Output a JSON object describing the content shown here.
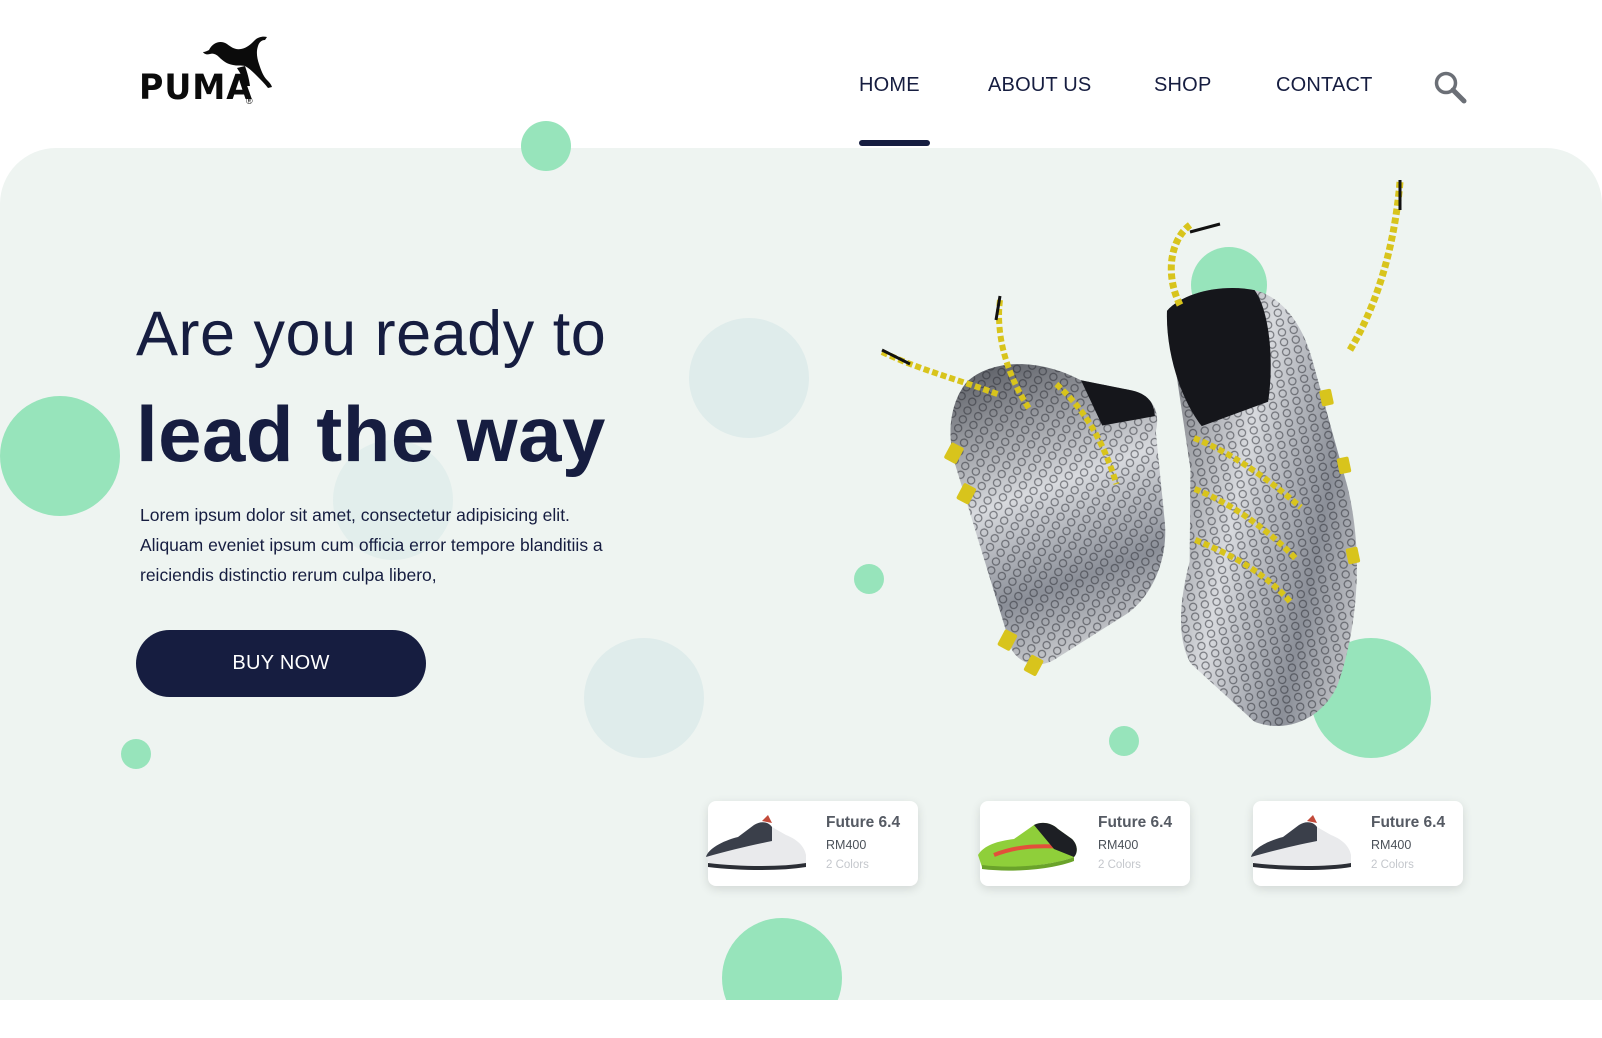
{
  "brand": {
    "logo_text": "PUMA",
    "logo_mark": "®"
  },
  "nav": {
    "items": [
      {
        "label": "HOME",
        "active": true
      },
      {
        "label": "ABOUT US",
        "active": false
      },
      {
        "label": "SHOP",
        "active": false
      },
      {
        "label": "CONTACT",
        "active": false
      }
    ],
    "search_icon": "search-icon"
  },
  "hero": {
    "headline_line1": "Are you ready to",
    "headline_line2": "lead the way",
    "description": "Lorem ipsum dolor sit amet, consectetur adipisicing elit. Aliquam eveniet ipsum cum officia error tempore blanditiis a reiciendis distinctio rerum culpa libero,",
    "cta_label": "BUY NOW",
    "image_icon": "football-boots-image"
  },
  "products": [
    {
      "name": "Future 6.4",
      "price": "RM400",
      "colors": "2 Colors",
      "image_icon": "sneaker-grey-image"
    },
    {
      "name": "Future 6.4",
      "price": "RM400",
      "colors": "2 Colors",
      "image_icon": "sneaker-green-image"
    },
    {
      "name": "Future 6.4",
      "price": "RM400",
      "colors": "2 Colors",
      "image_icon": "sneaker-grey-image"
    }
  ],
  "colors": {
    "navy": "#161d40",
    "hero_bg": "#eef4f1",
    "mint": "#97e4bb",
    "pale_circle": "#dfeceb",
    "boot_lace": "#d8c41c"
  }
}
